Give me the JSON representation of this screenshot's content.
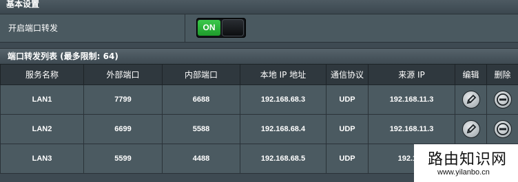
{
  "basic_settings": {
    "title": "基本设置",
    "enable_label": "开启端口转发",
    "toggle_state": "ON"
  },
  "forward_list": {
    "title": "端口转发列表 (最多限制: 64)",
    "columns": [
      "服务名称",
      "外部端口",
      "内部端口",
      "本地 IP 地址",
      "通信协议",
      "来源 IP",
      "编辑",
      "删除"
    ],
    "rows": [
      {
        "name": "LAN1",
        "ext_port": "7799",
        "int_port": "6688",
        "local_ip": "192.168.68.3",
        "protocol": "UDP",
        "source_ip": "192.168.11.3"
      },
      {
        "name": "LAN2",
        "ext_port": "6699",
        "int_port": "5588",
        "local_ip": "192.168.68.4",
        "protocol": "UDP",
        "source_ip": "192.168.11.3"
      },
      {
        "name": "LAN3",
        "ext_port": "5599",
        "int_port": "4488",
        "local_ip": "192.168.68.5",
        "protocol": "UDP",
        "source_ip": "192.168"
      }
    ]
  },
  "watermark": {
    "title": "路由知识网",
    "url": "www.yilanbo.cn"
  },
  "icons": {
    "edit": "pencil-icon",
    "delete": "minus-circle-icon"
  },
  "colors": {
    "toggle_on": "#2fb33d",
    "background": "#3e4a52"
  }
}
